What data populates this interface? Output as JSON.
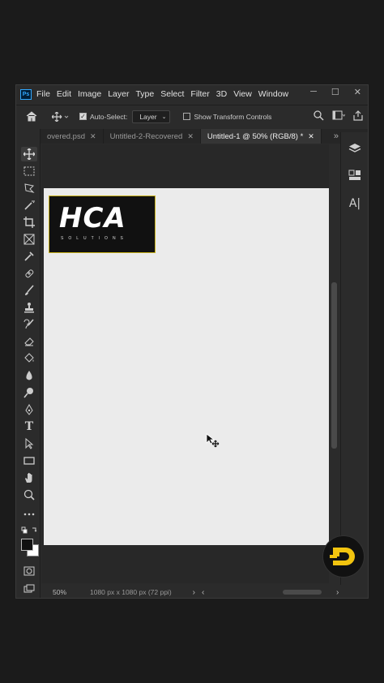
{
  "menu": {
    "items": [
      "File",
      "Edit",
      "Image",
      "Layer",
      "Type",
      "Select",
      "Filter",
      "3D",
      "View",
      "Window"
    ],
    "app_icon": "Ps"
  },
  "window_controls": {
    "minimize": "─",
    "maximize": "☐",
    "close": "✕"
  },
  "options": {
    "auto_select_label": "Auto-Select:",
    "auto_select_checked": true,
    "layer_select_value": "Layer",
    "transform_controls_label": "Show Transform Controls",
    "transform_controls_checked": false
  },
  "tabs": [
    {
      "label": "overed.psd",
      "active": false
    },
    {
      "label": "Untitled-2-Recovered",
      "active": false
    },
    {
      "label": "Untitled-1 @ 50% (RGB/8) *",
      "active": true
    }
  ],
  "canvas": {
    "logo_text": "HCA",
    "logo_sub": "SOLUTIONS"
  },
  "status": {
    "zoom": "50%",
    "dimensions": "1080 px x 1080 px (72 ppi)"
  },
  "colors": {
    "accent_gold": "#c9b21a",
    "ps_blue": "#31a8ff",
    "badge_yellow": "#f2c40f"
  }
}
